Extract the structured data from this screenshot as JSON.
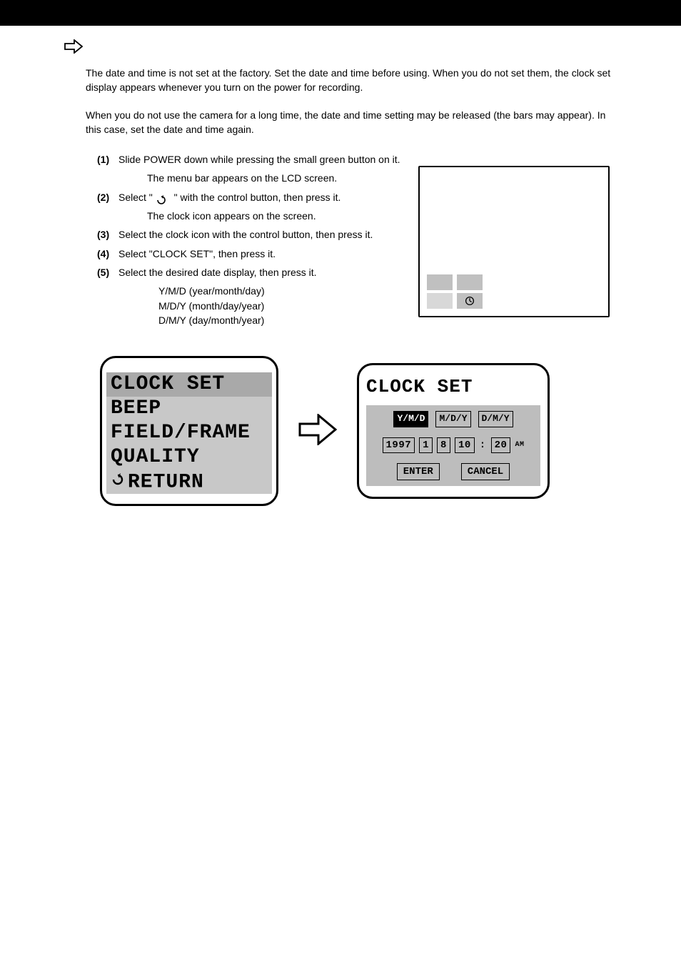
{
  "title_bar": "",
  "para1": "The date and time is not set at the factory.  Set the date and time before using. When you do not set them, the clock set display appears whenever you turn on the power for recording.",
  "para2": "When you do not use the camera for a long time, the date and time setting may be released (the bars may appear).  In this case, set the date and time again.",
  "steps": {
    "s1": {
      "num": "(1)",
      "text": "Slide POWER down while pressing the small green button on it.",
      "after": "The menu bar appears on the LCD screen."
    },
    "s2": {
      "num": "(2)",
      "text": "Select \"",
      "tail": "\" with the control button, then press it.",
      "note": "The clock icon appears on the screen."
    },
    "s3": {
      "num": "(3)",
      "text": "Select the clock icon with the control button, then press it."
    },
    "s4": {
      "num": "(4)",
      "text": "Select \"CLOCK SET\", then press it."
    },
    "s5": {
      "num": "(5)",
      "text": "Select the desired date display, then press it."
    },
    "s5_indent": "Y/M/D (year/month/day)\nM/D/Y (month/day/year)\nD/M/Y (day/month/year)"
  },
  "lcd1": {
    "items": [
      "CLOCK SET",
      "BEEP",
      "FIELD/FRAME",
      "QUALITY",
      "RETURN"
    ]
  },
  "lcd2": {
    "title": "CLOCK SET",
    "formats": [
      "Y/M/D",
      "M/D/Y",
      "D/M/Y"
    ],
    "year": "1997",
    "mon": "1",
    "day": "8",
    "hr": "10",
    "min": "20",
    "ampm": "AM",
    "enter": "ENTER",
    "cancel": "CANCEL"
  }
}
